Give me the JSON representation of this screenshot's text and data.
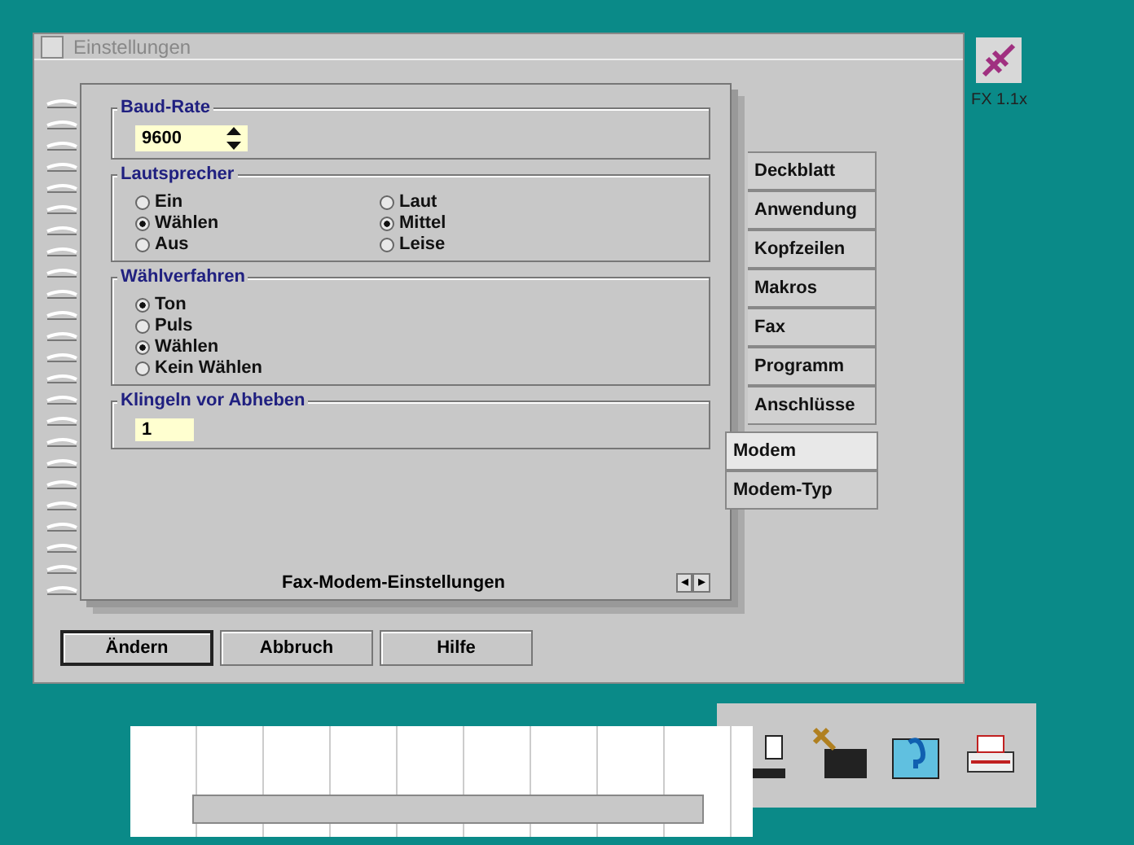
{
  "window": {
    "title": "Einstellungen"
  },
  "groups": [
    {
      "kind": "spin",
      "title": "Baud-Rate",
      "value": "9600"
    },
    {
      "kind": "radios",
      "title": "Lautsprecher",
      "options": [
        {
          "label": "Ein",
          "selected": false
        },
        {
          "label": "Wählen",
          "selected": true
        },
        {
          "label": "Aus",
          "selected": false
        },
        {
          "label": "Laut",
          "selected": false
        },
        {
          "label": "Mittel",
          "selected": true
        },
        {
          "label": "Leise",
          "selected": false
        }
      ]
    },
    {
      "kind": "radios",
      "title": "Wählverfahren",
      "options": [
        {
          "label": "Ton",
          "selected": true
        },
        {
          "label": "Puls",
          "selected": false
        },
        {
          "label": "Wählen",
          "selected": true
        },
        {
          "label": "Kein Wählen",
          "selected": false
        }
      ]
    },
    {
      "kind": "field",
      "title": "Klingeln vor Abheben",
      "value": "1"
    }
  ],
  "page_title": "Fax-Modem-Einstellungen",
  "page_arrows": [
    "◂",
    "▸"
  ],
  "major_tabs": [
    {
      "label": "Deckblatt",
      "selected": false
    },
    {
      "label": "Anwendung",
      "selected": false
    },
    {
      "label": "Kopfzeilen",
      "selected": false
    },
    {
      "label": "Makros",
      "selected": false
    },
    {
      "label": "Fax",
      "selected": false
    },
    {
      "label": "Programm",
      "selected": false
    },
    {
      "label": "Anschlüsse",
      "selected": false
    }
  ],
  "minor_tabs": [
    {
      "label": "Modem",
      "selected": true
    },
    {
      "label": "Modem-Typ",
      "selected": false
    }
  ],
  "buttons": [
    {
      "label": "Ändern",
      "default": true
    },
    {
      "label": "Abbruch",
      "default": false
    },
    {
      "label": "Hilfe",
      "default": false
    }
  ],
  "desktop_icon": {
    "label": "FX 1.1x"
  }
}
